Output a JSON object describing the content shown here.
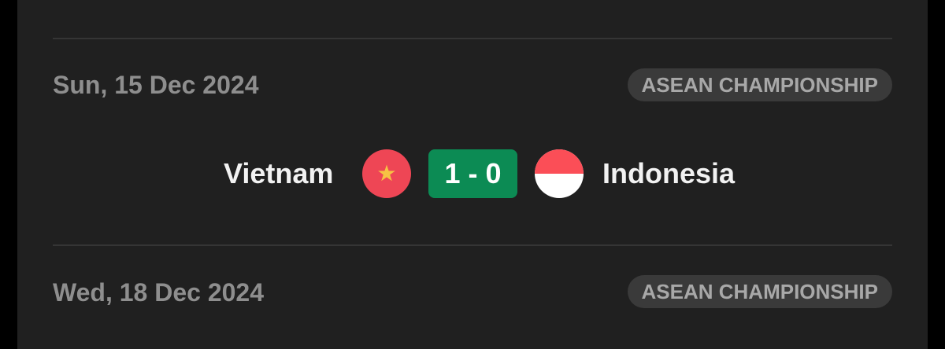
{
  "matches": [
    {
      "date": "Sun, 15 Dec 2024",
      "competition": "ASEAN CHAMPIONSHIP",
      "home_team": "Vietnam",
      "home_flag": "vietnam-flag-icon",
      "score": "1 - 0",
      "away_team": "Indonesia",
      "away_flag": "indonesia-flag-icon"
    },
    {
      "date": "Wed, 18 Dec 2024",
      "competition": "ASEAN CHAMPIONSHIP"
    }
  ],
  "colors": {
    "score_bg": "#0c8b54",
    "vietnam_red": "#ee4655",
    "vietnam_star": "#f6c244",
    "indonesia_red": "#fb4e57",
    "indonesia_white": "#ffffff",
    "panel_bg": "#202020",
    "badge_bg": "#3a3a3a"
  }
}
